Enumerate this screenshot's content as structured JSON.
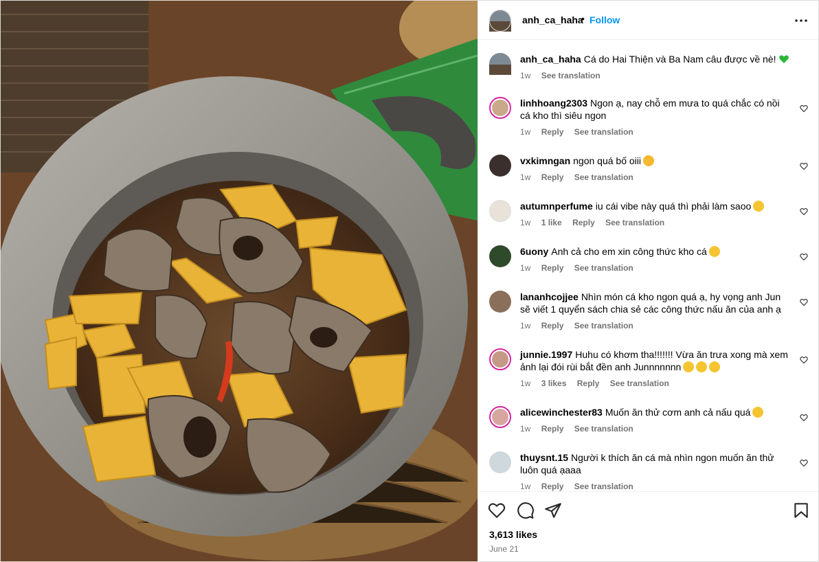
{
  "post": {
    "image_alt": "Photo by anh_ca_haha",
    "header": {
      "username": "anh_ca_haha",
      "separator": "•",
      "follow_label": "Follow",
      "more_icon": "more-horizontal-icon"
    },
    "caption": {
      "username": "anh_ca_haha",
      "text": "Cá do Hai Thiện và Ba Nam câu được về nè!",
      "emoji": "green-heart",
      "time": "1w",
      "translate": "See translation"
    },
    "comments": [
      {
        "username": "linhhoang2303",
        "text": "Ngon ạ, nay chỗ em mưa to quá chắc có nồi cá kho thì siêu ngon",
        "emoji": "",
        "time": "1w",
        "likes": "",
        "reply": "Reply",
        "translate": "See translation",
        "story": true,
        "avatar_color": "#c9a98a"
      },
      {
        "username": "vxkimngan",
        "text": "ngon quá bố oiii",
        "emoji": "tongue-face",
        "time": "1w",
        "likes": "",
        "reply": "Reply",
        "translate": "See translation",
        "story": false,
        "avatar_color": "#3a2f2c"
      },
      {
        "username": "autumnperfume",
        "text": "iu cái vibe này quá thì phải làm saoo",
        "emoji": "grinning-sweat",
        "time": "1w",
        "likes": "1 like",
        "reply": "Reply",
        "translate": "See translation",
        "story": false,
        "avatar_color": "#e8e2d8"
      },
      {
        "username": "6uony",
        "text": "Anh cả cho em xin công thức kho cá",
        "emoji": "hushed-face",
        "time": "1w",
        "likes": "",
        "reply": "Reply",
        "translate": "See translation",
        "story": false,
        "avatar_color": "#2f4a2a"
      },
      {
        "username": "lananhcojjee",
        "text": "Nhìn món cá kho ngon quá ạ, hy vọng anh Jun sẽ viết 1 quyển sách chia sẻ các công thức nấu ăn của anh ạ",
        "emoji": "",
        "time": "1w",
        "likes": "",
        "reply": "Reply",
        "translate": "See translation",
        "story": false,
        "avatar_color": "#8a6f5a"
      },
      {
        "username": "junnie.1997",
        "text": "Huhu có khơm tha!!!!!!! Vừa ăn trưa xong mà xem ảnh lại đói rùi bắt đền anh Junnnnnnn",
        "emoji": "loudly-crying x3",
        "time": "1w",
        "likes": "3 likes",
        "reply": "Reply",
        "translate": "See translation",
        "story": true,
        "avatar_color": "#c49a86"
      },
      {
        "username": "alicewinchester83",
        "text": "Muốn ăn thử cơm anh cả nấu quá",
        "emoji": "rolling-laughing",
        "time": "1w",
        "likes": "",
        "reply": "Reply",
        "translate": "See translation",
        "story": true,
        "avatar_color": "#d7a6a0"
      },
      {
        "username": "thuysnt.15",
        "text": "Người k thích ăn cá mà nhìn ngon muốn ăn thử luôn quá ạaaa",
        "emoji": "",
        "time": "1w",
        "likes": "",
        "reply": "Reply",
        "translate": "See translation",
        "story": false,
        "avatar_color": "#cfd8dd"
      }
    ],
    "actions": {
      "like_icon": "heart-icon",
      "comment_icon": "comment-icon",
      "share_icon": "share-icon",
      "save_icon": "bookmark-icon",
      "likes": "3,613 likes",
      "date": "June 21"
    }
  }
}
